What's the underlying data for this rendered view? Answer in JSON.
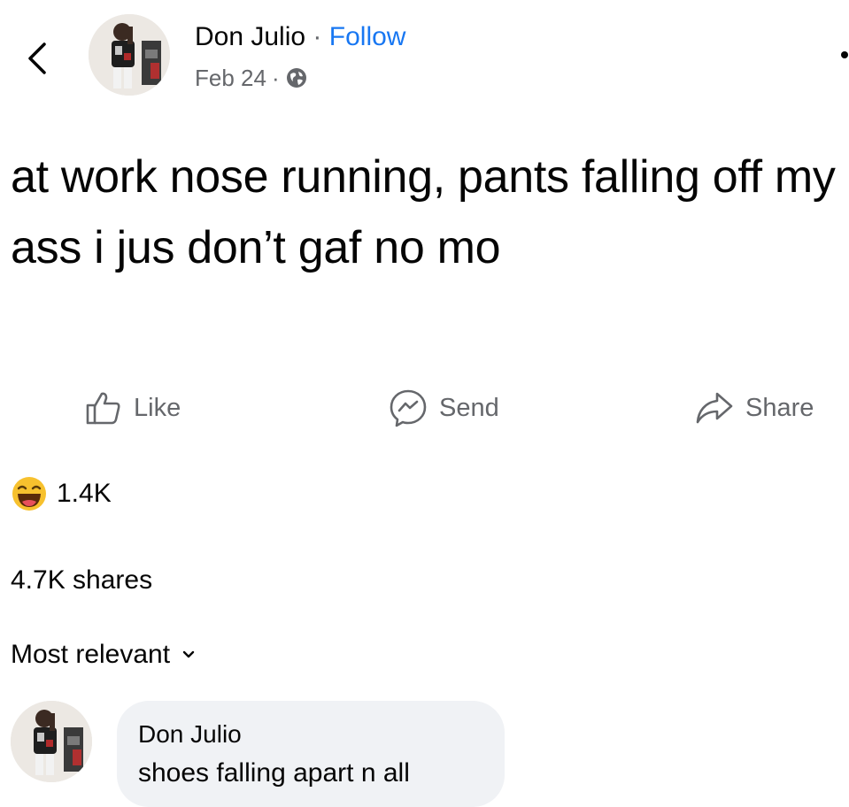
{
  "header": {
    "author": "Don Julio",
    "separator": "·",
    "follow": "Follow",
    "date": "Feb 24",
    "date_separator": "·",
    "privacy_icon": "globe-icon",
    "back_icon": "chevron-left-icon"
  },
  "post": {
    "text": "at work nose running, pants falling off my ass i jus don’t gaf no mo"
  },
  "actions": {
    "like": "Like",
    "send": "Send",
    "share": "Share"
  },
  "stats": {
    "reaction_icon": "haha-emoji-icon",
    "reaction_count": "1.4K",
    "shares": "4.7K shares"
  },
  "comments": {
    "sort_label": "Most relevant",
    "items": [
      {
        "author": "Don Julio",
        "text": "shoes falling apart n all"
      }
    ]
  },
  "colors": {
    "link": "#1877f2",
    "secondary_text": "#65676b",
    "primary_text": "#050505",
    "comment_bubble": "#f0f2f5",
    "background": "#ffffff"
  }
}
